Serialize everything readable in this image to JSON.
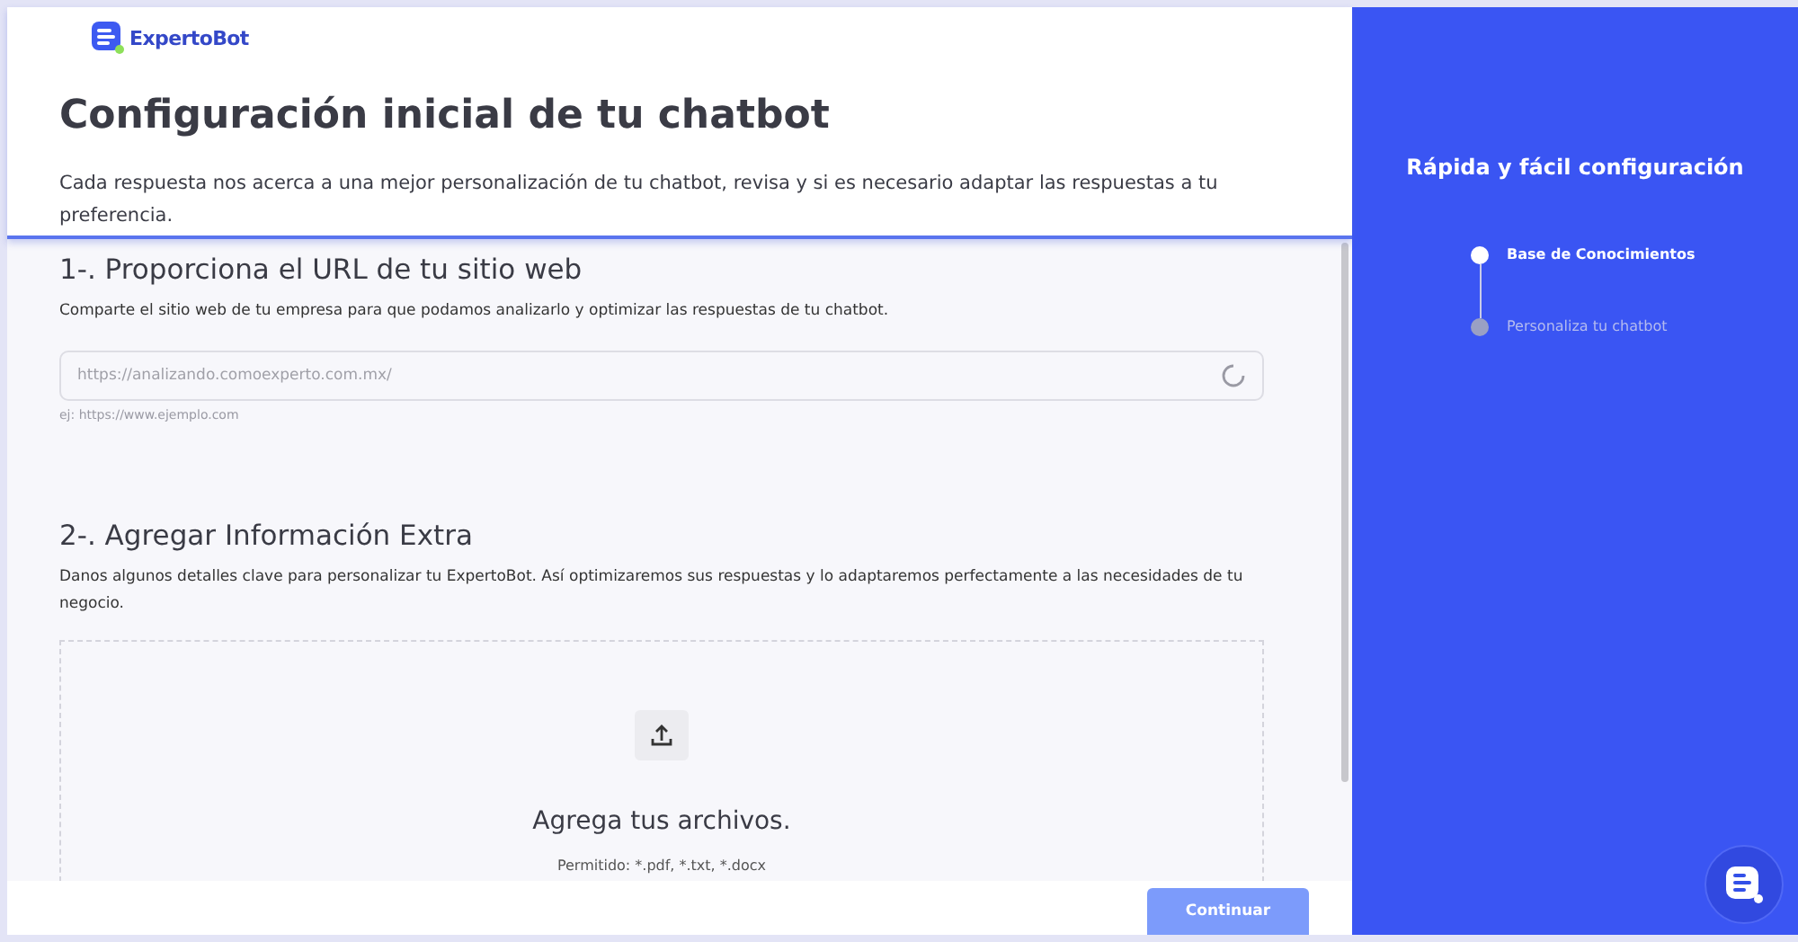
{
  "brand": {
    "name": "ExpertoBot"
  },
  "header": {
    "title": "Configuración inicial de tu chatbot",
    "description": "Cada respuesta nos acerca a una mejor personalización de tu chatbot, revisa y si es necesario adaptar las respuestas a tu preferencia."
  },
  "sections": [
    {
      "kind": "url",
      "heading": "1-. Proporciona el URL de tu sitio web",
      "description": "Comparte el sitio web de tu empresa para que podamos analizarlo y optimizar las respuestas de tu chatbot.",
      "placeholder": "https://analizando.comoexperto.com.mx/",
      "hint": "ej: https://www.ejemplo.com"
    },
    {
      "kind": "upload",
      "heading": "2-. Agregar Información Extra",
      "description": "Danos algunos detalles clave para personalizar tu ExpertoBot. Así optimizaremos sus respuestas y lo adaptaremos perfectamente a las necesidades de tu negocio.",
      "title": "Agrega tus archivos.",
      "allowed": "Permitido: *.pdf, *.txt, *.docx"
    }
  ],
  "footer": {
    "button": "Continuar"
  },
  "sidebar": {
    "title": "Rápida y fácil configuración",
    "steps": [
      {
        "label": "Base de Conocimientos",
        "selected": true
      },
      {
        "label": "Personaliza tu chatbot",
        "selected": false
      }
    ]
  }
}
